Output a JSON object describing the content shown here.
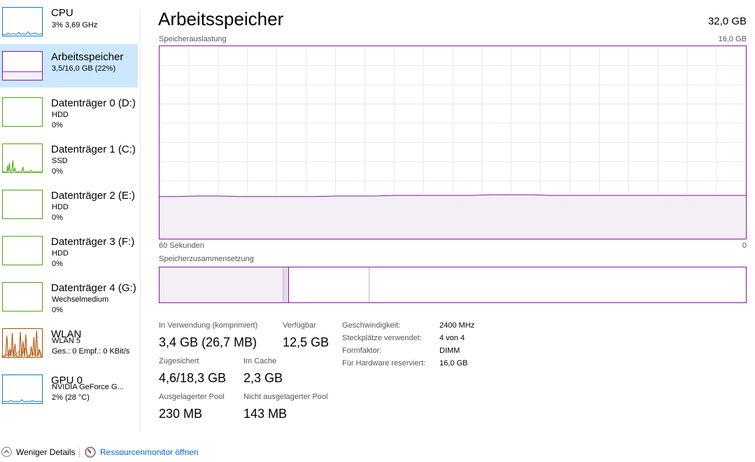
{
  "sidebar": {
    "items": [
      {
        "title": "CPU",
        "line1": "3%  3,69 GHz",
        "line2": "",
        "color": "#117dbb"
      },
      {
        "title": "Arbeitsspeicher",
        "line1": "3,5/16,0 GB (22%)",
        "line2": "",
        "color": "#8b12ae"
      },
      {
        "title": "Datenträger 0 (D:)",
        "line1": "HDD",
        "line2": "0%",
        "color": "#4da60c"
      },
      {
        "title": "Datenträger 1 (C:)",
        "line1": "SSD",
        "line2": "0%",
        "color": "#4da60c"
      },
      {
        "title": "Datenträger 2 (E:)",
        "line1": "HDD",
        "line2": "0%",
        "color": "#4da60c"
      },
      {
        "title": "Datenträger 3 (F:)",
        "line1": "HDD",
        "line2": "0%",
        "color": "#4da60c"
      },
      {
        "title": "Datenträger 4 (G:)",
        "line1": "Wechselmedium",
        "line2": "0%",
        "color": "#4da60c"
      },
      {
        "title": "WLAN",
        "line1": "WLAN 5",
        "line2": "Ges.: 0  Empf.: 0 KBit/s",
        "color": "#a74f01"
      },
      {
        "title": "GPU 0",
        "line1": "NVIDIA GeForce G...",
        "line2": "2%  (28 °C)",
        "color": "#117dbb"
      }
    ]
  },
  "main": {
    "title": "Arbeitsspeicher",
    "total": "32,0 GB",
    "usage_label": "Speicherauslastung",
    "usage_max": "16,0 GB",
    "time_left": "60 Sekunden",
    "time_right": "0",
    "composition_label": "Speicherzusammensetzung"
  },
  "chart_data": {
    "type": "area",
    "ylim": [
      0,
      16
    ],
    "y_unit": "GB",
    "x_seconds": [
      60,
      0
    ],
    "values": [
      3.5,
      3.5,
      3.55,
      3.55,
      3.5,
      3.5,
      3.5,
      3.5,
      3.5,
      3.55,
      3.55,
      3.55,
      3.6,
      3.6,
      3.6,
      3.6,
      3.6,
      3.65,
      3.65,
      3.65,
      3.6,
      3.6,
      3.6,
      3.6,
      3.6,
      3.6,
      3.6,
      3.6,
      3.6,
      3.6,
      3.6
    ],
    "grid": true,
    "color": "#8b12ae"
  },
  "stats": {
    "in_use_label": "In Verwendung (komprimiert)",
    "in_use_value": "3,4 GB (26,7 MB)",
    "available_label": "Verfügbar",
    "available_value": "12,5 GB",
    "committed_label": "Zugesichert",
    "committed_value": "4,6/18,3 GB",
    "cached_label": "Im Cache",
    "cached_value": "2,3 GB",
    "paged_label": "Ausgelagerter Pool",
    "paged_value": "230 MB",
    "nonpaged_label": "Nicht ausgelagerter Pool",
    "nonpaged_value": "143 MB"
  },
  "details": [
    {
      "label": "Geschwindigkeit:",
      "value": "2400 MHz"
    },
    {
      "label": "Steckplätze verwendet:",
      "value": "4 von 4"
    },
    {
      "label": "Formfaktor:",
      "value": "DIMM"
    },
    {
      "label": "Für Hardware reserviert:",
      "value": "16,0 GB"
    }
  ],
  "footer": {
    "fewer_details": "Weniger Details",
    "resource_monitor": "Ressourcenmonitor öffnen"
  }
}
